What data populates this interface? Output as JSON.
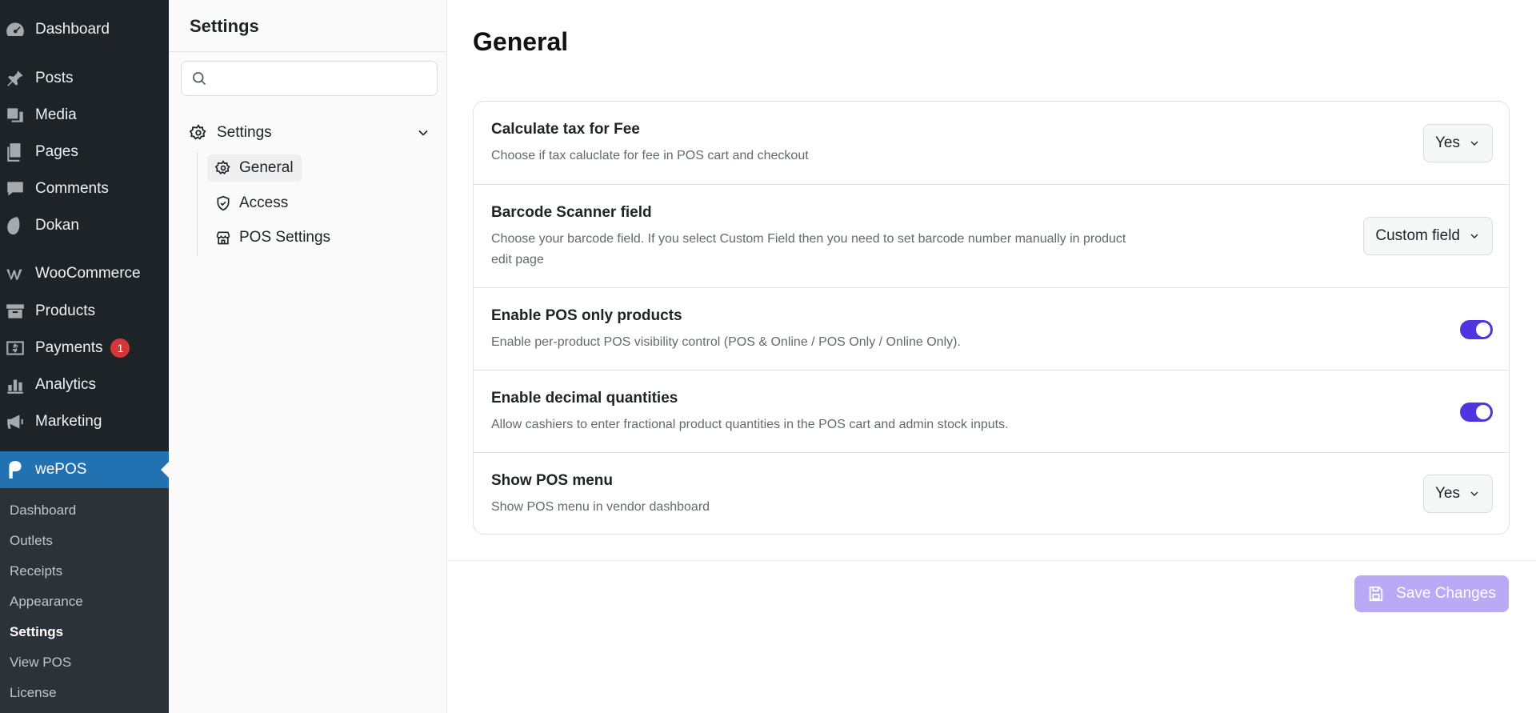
{
  "wp_menu": {
    "items": [
      {
        "label": "Dashboard",
        "icon": "dashboard-icon"
      },
      {
        "label": "Posts",
        "icon": "pin-icon"
      },
      {
        "label": "Media",
        "icon": "media-icon"
      },
      {
        "label": "Pages",
        "icon": "pages-icon"
      },
      {
        "label": "Comments",
        "icon": "comment-icon"
      },
      {
        "label": "Dokan",
        "icon": "dokan-icon"
      },
      {
        "label": "WooCommerce",
        "icon": "woocommerce-icon"
      },
      {
        "label": "Products",
        "icon": "archive-icon"
      },
      {
        "label": "Payments",
        "icon": "dollar-icon",
        "badge": "1"
      },
      {
        "label": "Analytics",
        "icon": "bar-chart-icon"
      },
      {
        "label": "Marketing",
        "icon": "megaphone-icon"
      },
      {
        "label": "wePOS",
        "icon": "wepos-icon"
      }
    ],
    "submenu": [
      "Dashboard",
      "Outlets",
      "Receipts",
      "Appearance",
      "Settings",
      "View POS",
      "License"
    ],
    "current_submenu": "Settings"
  },
  "settings_nav": {
    "title": "Settings",
    "search_placeholder": "",
    "group_label": "Settings",
    "items": [
      "General",
      "Access",
      "POS Settings"
    ],
    "active": "General"
  },
  "main": {
    "title": "General",
    "rows": [
      {
        "label": "Calculate tax for Fee",
        "desc": "Choose if tax caluclate for fee in POS cart and checkout",
        "control": "select",
        "value": "Yes"
      },
      {
        "label": "Barcode Scanner field",
        "desc": "Choose your barcode field. If you select Custom Field then you need to set barcode number manually in product edit page",
        "control": "select",
        "value": "Custom field"
      },
      {
        "label": "Enable POS only products",
        "desc": "Enable per-product POS visibility control (POS & Online / POS Only / Online Only).",
        "control": "toggle",
        "value": true
      },
      {
        "label": "Enable decimal quantities",
        "desc": "Allow cashiers to enter fractional product quantities in the POS cart and admin stock inputs.",
        "control": "toggle",
        "value": true
      },
      {
        "label": "Show POS menu",
        "desc": "Show POS menu in vendor dashboard",
        "control": "select",
        "value": "Yes"
      }
    ],
    "save_label": "Save Changes"
  },
  "colors": {
    "sidebar_bg": "#1d2327",
    "active_menu": "#2271b1",
    "toggle_on": "#4f35e0",
    "save_button": "#b8aaf5",
    "badge": "#d63638"
  }
}
